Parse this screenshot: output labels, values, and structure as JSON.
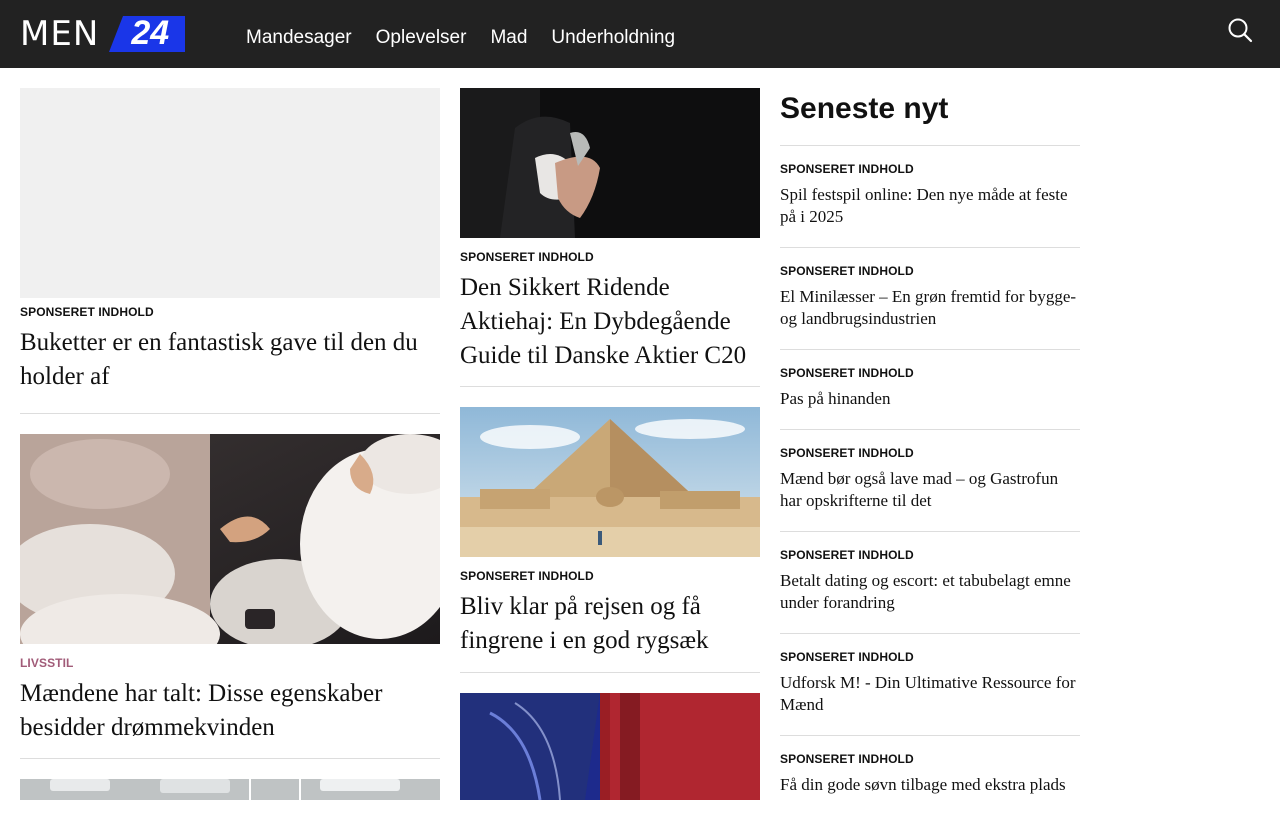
{
  "brand": {
    "name": "MEN",
    "number": "24",
    "accent": "#1a36e8"
  },
  "nav": {
    "items": [
      "Mandesager",
      "Oplevelser",
      "Mad",
      "Underholdning"
    ]
  },
  "header": {
    "search_icon": "search-icon"
  },
  "col1": [
    {
      "category": "SPONSERET INDHOLD",
      "title": "Buketter er en fantastisk gave til den du holder af",
      "image": "placeholder"
    },
    {
      "category": "LIVSSTIL",
      "title": "Mændene har talt: Disse egenskaber besidder drømmekvinden",
      "image": "couple-in-car-holding-hands"
    }
  ],
  "col2": [
    {
      "category": "SPONSERET INDHOLD",
      "title": "Den Sikkert Ridende Aktiehaj: En Dybdegående Guide til Danske Aktier C20",
      "image": "handshake-suit"
    },
    {
      "category": "SPONSERET INDHOLD",
      "title": "Bliv klar på rejsen og få fingrene i en god rygsæk",
      "image": "pyramid-sphinx"
    }
  ],
  "sidebar": {
    "heading": "Seneste nyt",
    "items": [
      {
        "category": "SPONSERET INDHOLD",
        "title": "Spil festspil online: Den nye måde at feste på i 2025"
      },
      {
        "category": "SPONSERET INDHOLD",
        "title": "El Minilæsser – En grøn fremtid for bygge- og landbrugsindustrien"
      },
      {
        "category": "SPONSERET INDHOLD",
        "title": "Pas på hinanden"
      },
      {
        "category": "SPONSERET INDHOLD",
        "title": "Mænd bør også lave mad – og Gastrofun har opskrifterne til det"
      },
      {
        "category": "SPONSERET INDHOLD",
        "title": "Betalt dating og escort: et tabubelagt emne under forandring"
      },
      {
        "category": "SPONSERET INDHOLD",
        "title": "Udforsk M! - Din Ultimative Ressource for Mænd"
      },
      {
        "category": "SPONSERET INDHOLD",
        "title": "Få din gode søvn tilbage med ekstra plads"
      }
    ]
  }
}
